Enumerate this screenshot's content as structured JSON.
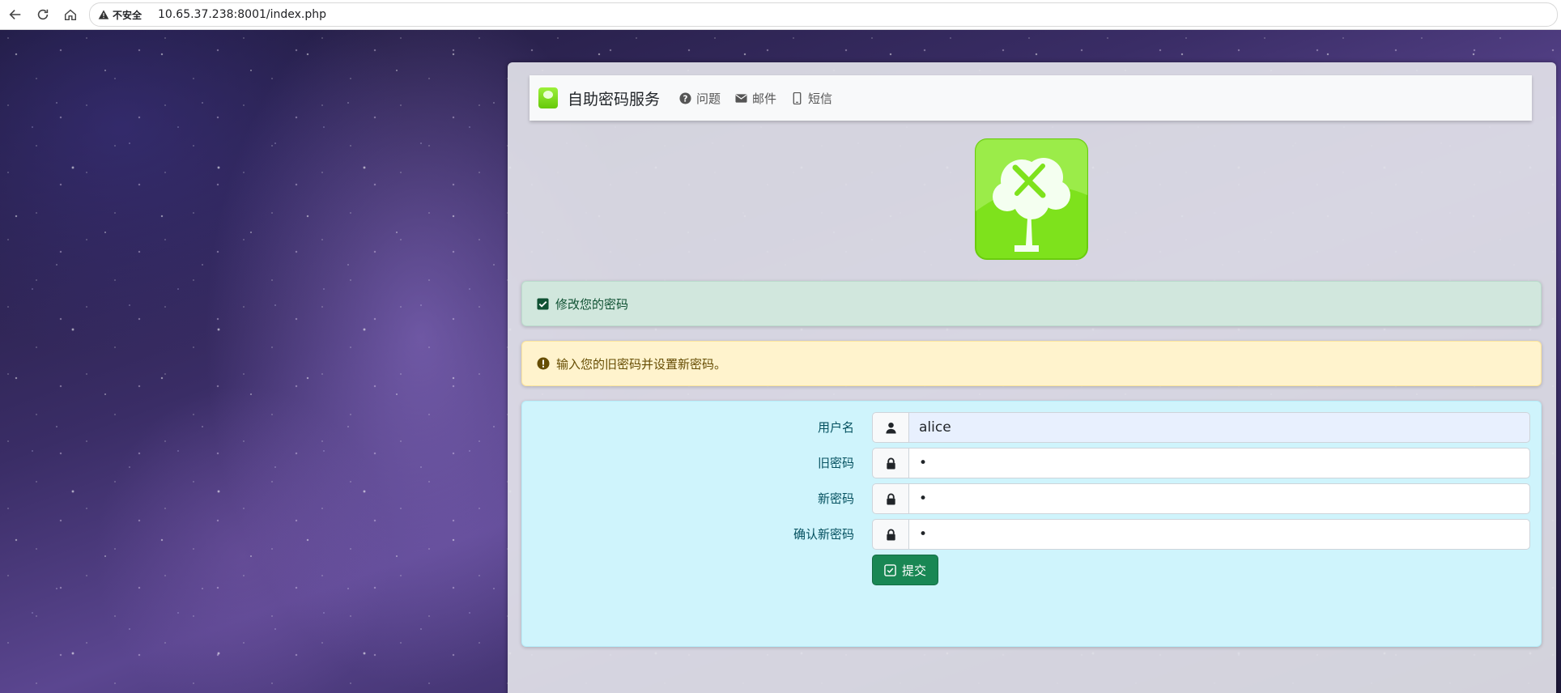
{
  "browser": {
    "security_label": "不安全",
    "url": "10.65.37.238:8001/index.php"
  },
  "navbar": {
    "brand": "自助密码服务",
    "links": [
      {
        "label": "问题",
        "icon": "question-circle-icon"
      },
      {
        "label": "邮件",
        "icon": "envelope-icon"
      },
      {
        "label": "短信",
        "icon": "mobile-icon"
      }
    ]
  },
  "alerts": {
    "success": "修改您的密码",
    "warning": "输入您的旧密码并设置新密码。"
  },
  "form": {
    "username_label": "用户名",
    "username_value": "alice",
    "old_password_label": "旧密码",
    "old_password_value": "•",
    "new_password_label": "新密码",
    "new_password_value": "•",
    "confirm_password_label": "确认新密码",
    "confirm_password_value": "•",
    "submit_label": "提交"
  },
  "colors": {
    "success_bg": "#d1e7dd",
    "warning_bg": "#fff3cd",
    "info_bg": "#cff4fc",
    "submit_bg": "#198754",
    "logo_green": "#7ee21c"
  }
}
